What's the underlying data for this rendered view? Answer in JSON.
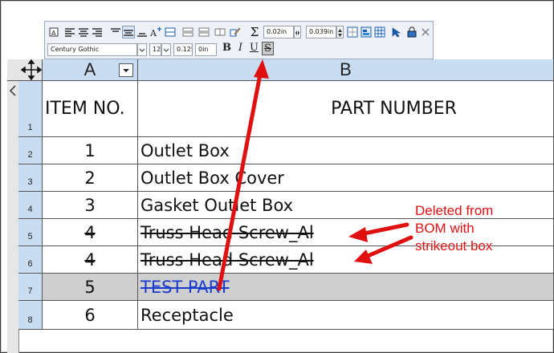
{
  "toolbar": {
    "row1_icons": [
      "table-anchor-icon",
      "align-left-icon",
      "align-center-icon",
      "align-right-icon",
      "valign-top-icon",
      "valign-middle-icon",
      "valign-bottom-icon",
      "text-format-icon",
      "insert-row-icon",
      "insert-column-icon",
      "delete-row-icon",
      "delete-column-icon",
      "edit-icon",
      "sum-icon",
      "border-icon",
      "properties-icon",
      "grid-icon",
      "lock-icon",
      "close-icon"
    ],
    "sum_symbol": "Σ",
    "cell_padding_value": "0.02in",
    "row_height_value": "0.039in",
    "font_name": "Century Gothic",
    "font_size": "12",
    "text_height": "0.125in",
    "text_offset": "0in",
    "bold_label": "B",
    "italic_label": "I",
    "underline_label": "U",
    "strikeout_label": "S"
  },
  "table": {
    "columns": [
      {
        "letter": "A",
        "header": "ITEM NO."
      },
      {
        "letter": "B",
        "header": "PART NUMBER"
      }
    ],
    "rows": [
      {
        "num": "1",
        "item": "ITEM NO.",
        "part": "PART NUMBER"
      },
      {
        "num": "2",
        "item": "1",
        "part": "Outlet Box"
      },
      {
        "num": "3",
        "item": "2",
        "part": "Outlet Box Cover"
      },
      {
        "num": "4",
        "item": "3",
        "part": "Gasket Outlet Box"
      },
      {
        "num": "5",
        "item": "4",
        "part": "Truss Head Screw_Al"
      },
      {
        "num": "6",
        "item": "4",
        "part": "Truss Head Screw_Al"
      },
      {
        "num": "7",
        "item": "5",
        "part": "TEST PART"
      },
      {
        "num": "8",
        "item": "6",
        "part": "Receptacle"
      }
    ]
  },
  "annotation": {
    "text_line1": "Deleted from",
    "text_line2": "BOM with",
    "text_line3": "strikeout box",
    "color": "#e01010"
  },
  "colors": {
    "header_bg": "#c9ddf2",
    "selected_row_bg": "#cfcfcf",
    "link_blue": "#1a3ccc"
  }
}
